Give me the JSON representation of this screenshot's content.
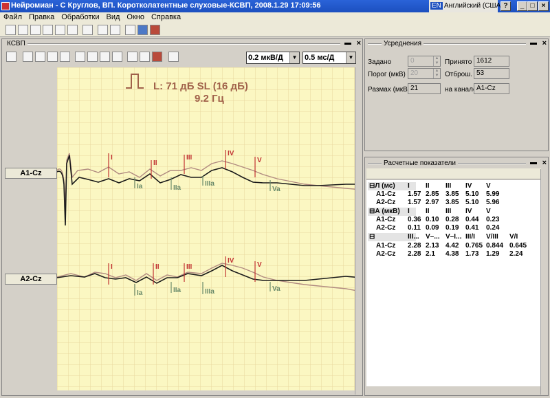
{
  "window": {
    "title": "Нейромиан - С Круглов, ВП. Коротколатентные слуховые-КСВП, 2008.1.29 17:09:56",
    "language_code": "EN",
    "language": "Английский (США)",
    "help": "?",
    "min": "_",
    "max": "□",
    "close": "×"
  },
  "menu": [
    "Файл",
    "Правка",
    "Обработки",
    "Вид",
    "Окно",
    "Справка"
  ],
  "ksvp": {
    "title": "КСВП",
    "amp_scale": "0.2 мкВ/Д",
    "time_scale": "0.5 мс/Д",
    "stimulus": "L: 71 дБ SL (16 дБ)",
    "rate": "9.2 Гц",
    "channels": [
      "A1-Cz",
      "A2-Cz"
    ],
    "wave_labels_top": [
      "I",
      "II",
      "III",
      "IV",
      "V"
    ],
    "wave_labels_bottom": [
      "Ia",
      "IIa",
      "IIIa",
      "Va"
    ]
  },
  "averaging": {
    "title": "Усреднения",
    "given_label": "Задано",
    "given": "0",
    "accepted_label": "Принято",
    "accepted": "1612",
    "threshold_label": "Порог (мкВ)",
    "threshold": "20",
    "rejected_label": "Отброш.",
    "rejected": "53",
    "range_label": "Размах (мкВ)",
    "range": "21",
    "channel_label": "на канале",
    "channel": "A1-Cz"
  },
  "calc": {
    "title": "Расчетные показатели",
    "groups": [
      {
        "name": "⊟Л (мс)",
        "cols": [
          "I",
          "II",
          "III",
          "IV",
          "V"
        ],
        "rows": [
          {
            "ch": "A1-Cz",
            "v": [
              "1.57",
              "2.85",
              "3.85",
              "5.10",
              "5.99"
            ]
          },
          {
            "ch": "A2-Cz",
            "v": [
              "1.57",
              "2.97",
              "3.85",
              "5.10",
              "5.96"
            ]
          }
        ]
      },
      {
        "name": "⊟А (мкВ)",
        "cols": [
          "I",
          "II",
          "III",
          "IV",
          "V"
        ],
        "rows": [
          {
            "ch": "A1-Cz",
            "v": [
              "0.36",
              "0.10",
              "0.28",
              "0.44",
              "0.23"
            ]
          },
          {
            "ch": "A2-Cz",
            "v": [
              "0.11",
              "0.09",
              "0.19",
              "0.41",
              "0.24"
            ]
          }
        ]
      },
      {
        "name": "⊟",
        "cols": [
          "III...",
          "V–...",
          "V–I...",
          "III/I",
          "V/III",
          "V/I"
        ],
        "rows": [
          {
            "ch": "A1-Cz",
            "v": [
              "2.28",
              "2.13",
              "4.42",
              "0.765",
              "0.844",
              "0.645"
            ]
          },
          {
            "ch": "A2-Cz",
            "v": [
              "2.28",
              "2.1",
              "4.38",
              "1.73",
              "1.29",
              "2.24"
            ]
          }
        ]
      }
    ]
  },
  "colors": {
    "plot_bg": "#fbf7c2",
    "grid": "#e8d9a8",
    "trace_dark": "#1a1a1a",
    "trace_light": "#b08a80",
    "marker": "#c03030",
    "marker_b": "#6a8a6a",
    "stim": "#a0614a"
  }
}
